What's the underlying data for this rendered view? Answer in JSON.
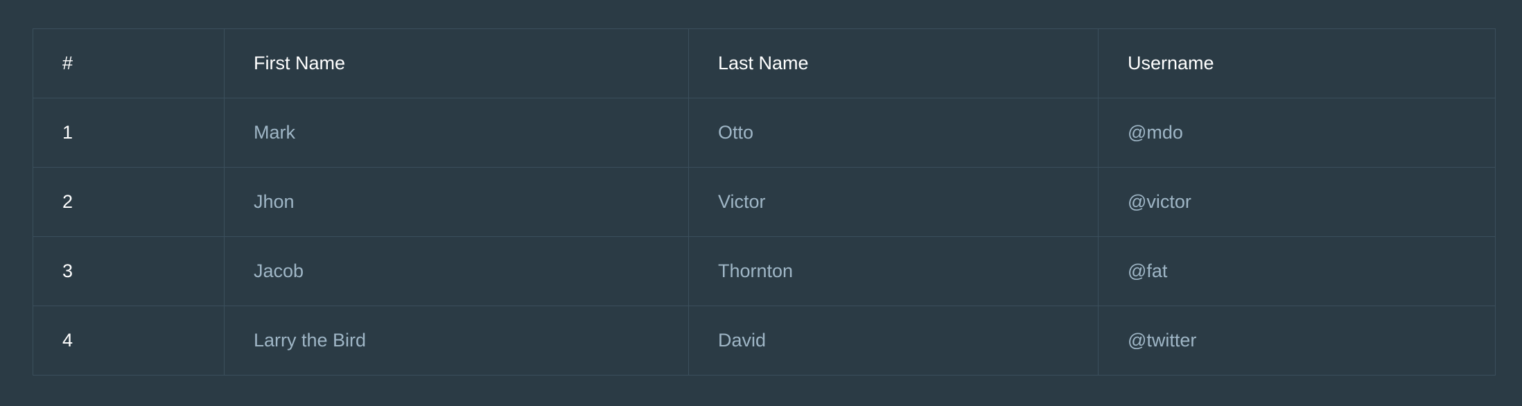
{
  "table": {
    "headers": [
      "#",
      "First Name",
      "Last Name",
      "Username"
    ],
    "rows": [
      [
        "1",
        "Mark",
        "Otto",
        "@mdo"
      ],
      [
        "2",
        "Jhon",
        "Victor",
        "@victor"
      ],
      [
        "3",
        "Jacob",
        "Thornton",
        "@fat"
      ],
      [
        "4",
        "Larry the Bird",
        "David",
        "@twitter"
      ]
    ]
  },
  "colors": {
    "background": "#2b3b45",
    "border": "#3b4f5c",
    "header_text": "#ffffff",
    "cell_text": "#9fb6c6"
  }
}
